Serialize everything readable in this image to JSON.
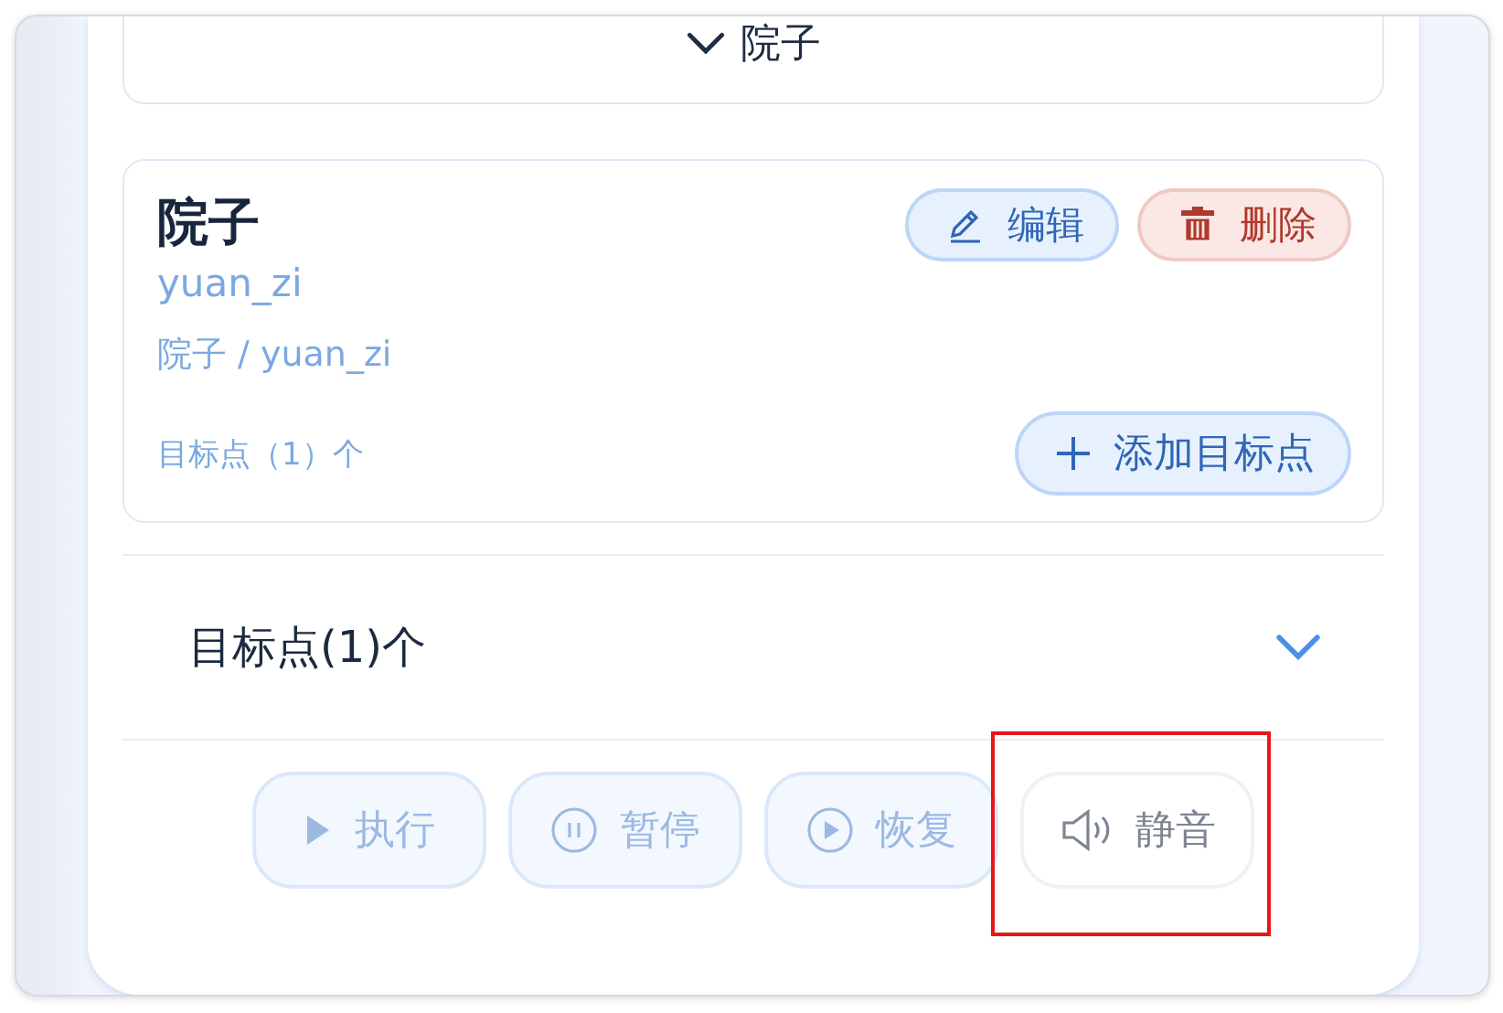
{
  "collapsed_section": {
    "title": "院子",
    "expanded": false
  },
  "area_card": {
    "title": "院子",
    "code": "yuan_zi",
    "path": "院子 / yuan_zi",
    "target_count": "目标点（1）个",
    "actions": [
      {
        "kind": "edit",
        "label": "编辑"
      },
      {
        "kind": "delete",
        "label": "删除"
      }
    ],
    "add_button": "添加目标点"
  },
  "targets_section": {
    "title": "目标点(1)个",
    "expanded": false
  },
  "controls": [
    {
      "kind": "play",
      "label": "执行",
      "disabled": true,
      "highlighted": false
    },
    {
      "kind": "pause",
      "label": "暂停",
      "disabled": true,
      "highlighted": false
    },
    {
      "kind": "resume",
      "label": "恢复",
      "disabled": true,
      "highlighted": false
    },
    {
      "kind": "mute",
      "label": "静音",
      "disabled": false,
      "highlighted": true
    }
  ]
}
